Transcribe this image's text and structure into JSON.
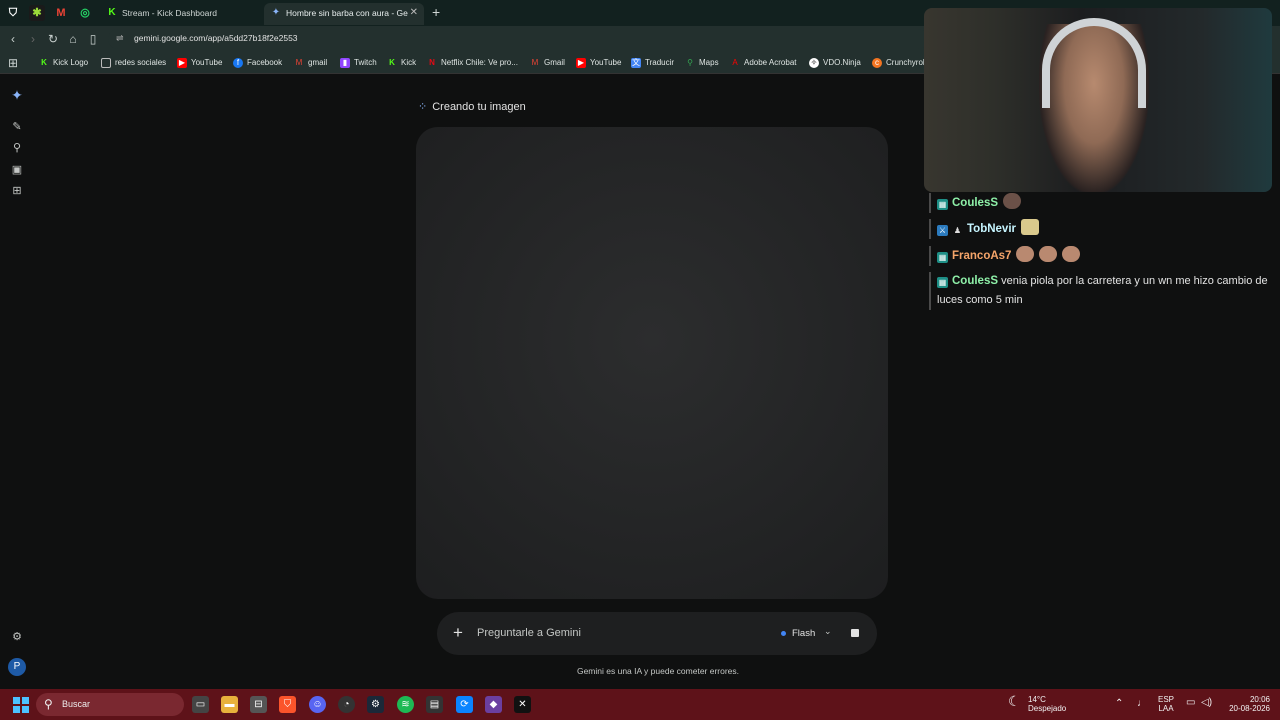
{
  "browser": {
    "tabs": [
      {
        "title": "Stream - Kick Dashboard",
        "icon": "kick-icon"
      },
      {
        "title": "Hombre sin barba con aura - Ge",
        "icon": "gemini-icon",
        "active": true
      }
    ],
    "url": "gemini.google.com/app/a5dd27b18f2e2553",
    "bookmarks": [
      "Kick Logo",
      "redes sociales",
      "YouTube",
      "Facebook",
      "gmail",
      "Twitch",
      "Kick",
      "Netflix Chile: Ve pro...",
      "Gmail",
      "YouTube",
      "Traducir",
      "Maps",
      "Adobe Acrobat",
      "VDO.Ninja",
      "Crunchyroll"
    ]
  },
  "gemini": {
    "status": "Creando tu imagen",
    "input_placeholder": "Preguntarle a Gemini",
    "model": "Flash",
    "disclaimer": "Gemini es una IA y puede cometer errores.",
    "avatar_letter": "P"
  },
  "chat": [
    {
      "user": "CoulesS",
      "color": "#8ef0a8",
      "message": ""
    },
    {
      "user": "TobNevir",
      "color": "#c6f5ff",
      "message": ""
    },
    {
      "user": "FrancoAs7",
      "color": "#f5a56a",
      "message": ""
    },
    {
      "user": "CoulesS",
      "color": "#8ef0a8",
      "message": "venia piola por la carretera y un wn me hizo cambio de luces como 5 min"
    }
  ],
  "taskbar": {
    "search_label": "Buscar",
    "weather_temp": "14°C",
    "weather_text": "Despejado",
    "lang_top": "ESP",
    "lang_bottom": "LAA",
    "time": "20:06",
    "date": "20-08-2026"
  },
  "colors": {
    "accent": "#4285f4",
    "taskbar": "#5e1219",
    "tabstrip": "#12211f"
  }
}
